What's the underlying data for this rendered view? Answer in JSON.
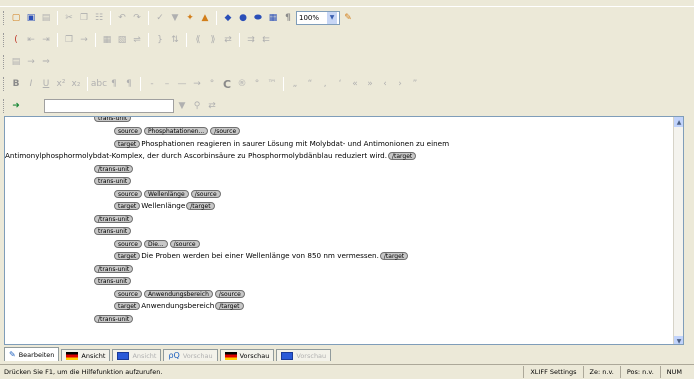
{
  "toolbars": {
    "zoom_value": "100%",
    "find_value": ""
  },
  "document": {
    "lines": [
      {
        "kind": "tag",
        "text": "trans-unit"
      },
      {
        "kind": "pair",
        "open": "source",
        "content": "Phosphatationen...",
        "close": "/source"
      },
      {
        "kind": "target-start",
        "open": "target",
        "content": "Phosphationen reagieren in saurer Lösung mit Molybdat- und  Antimonionen zu einem"
      },
      {
        "kind": "target-end",
        "content": "Antimonylphosphormolybdat-Komplex, der  durch Ascorbinsäure zu Phosphormolybdänblau reduziert wird.",
        "close": "/target"
      },
      {
        "kind": "tag",
        "text": "/trans-unit"
      },
      {
        "kind": "tag",
        "text": "trans-unit"
      },
      {
        "kind": "pair",
        "open": "source",
        "content": "Wellenlänge",
        "close": "/source"
      },
      {
        "kind": "pair-text",
        "open": "target",
        "content": "Wellenlänge",
        "close": "/target"
      },
      {
        "kind": "tag",
        "text": "/trans-unit"
      },
      {
        "kind": "tag",
        "text": "trans-unit"
      },
      {
        "kind": "pair",
        "open": "source",
        "content": "Die...",
        "close": "/source"
      },
      {
        "kind": "pair-text",
        "open": "target",
        "content": "Die Proben werden bei einer Wellenlänge von 850 nm vermessen.",
        "close": "/target"
      },
      {
        "kind": "tag",
        "text": "/trans-unit"
      },
      {
        "kind": "tag",
        "text": "trans-unit"
      },
      {
        "kind": "pair",
        "open": "source",
        "content": "Anwendungsbereich",
        "close": "/source"
      },
      {
        "kind": "pair-text",
        "open": "target",
        "content": "Anwendungsbereich",
        "close": "/target"
      },
      {
        "kind": "tag",
        "text": "/trans-unit"
      }
    ]
  },
  "tabs": [
    {
      "label": "Bearbeiten",
      "state": "active"
    },
    {
      "label": "Ansicht",
      "state": "normal"
    },
    {
      "label": "Ansicht",
      "state": "disabled"
    },
    {
      "label": "Vorschau",
      "state": "disabled"
    },
    {
      "label": "Vorschau",
      "state": "normal"
    },
    {
      "label": "Vorschau",
      "state": "disabled"
    }
  ],
  "status": {
    "message": "Drücken Sie F1, um die Hilfefunktion aufzurufen.",
    "settings": "XLIFF Settings",
    "line": "Ze: n.v.",
    "pos": "Pos: n.v.",
    "num": "NUM"
  }
}
